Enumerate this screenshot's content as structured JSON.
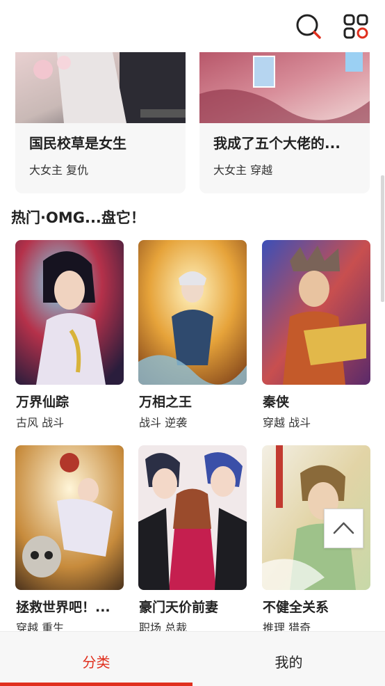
{
  "colors": {
    "accent": "#e0301e",
    "text": "#222222"
  },
  "header": {
    "search_icon": "search-icon",
    "menu_icon": "grid-menu-icon"
  },
  "top_cards": [
    {
      "title": "国民校草是女生",
      "tags": "大女主 复仇"
    },
    {
      "title": "我成了五个大佬的...",
      "tags": "大女主 穿越"
    }
  ],
  "section": {
    "title": "热门·OMG...盘它！"
  },
  "comics": [
    {
      "name": "万界仙踪",
      "tags": "古风 战斗"
    },
    {
      "name": "万相之王",
      "tags": "战斗 逆袭"
    },
    {
      "name": "秦侠",
      "tags": "穿越 战斗"
    },
    {
      "name": "拯救世界吧！...",
      "tags": "穿越 重生"
    },
    {
      "name": "豪门天价前妻",
      "tags": "职场 总裁"
    },
    {
      "name": "不健全关系",
      "tags": "推理 猎奇"
    }
  ],
  "bottom_nav": {
    "tab_category": "分类",
    "tab_mine": "我的",
    "active": "分类"
  }
}
